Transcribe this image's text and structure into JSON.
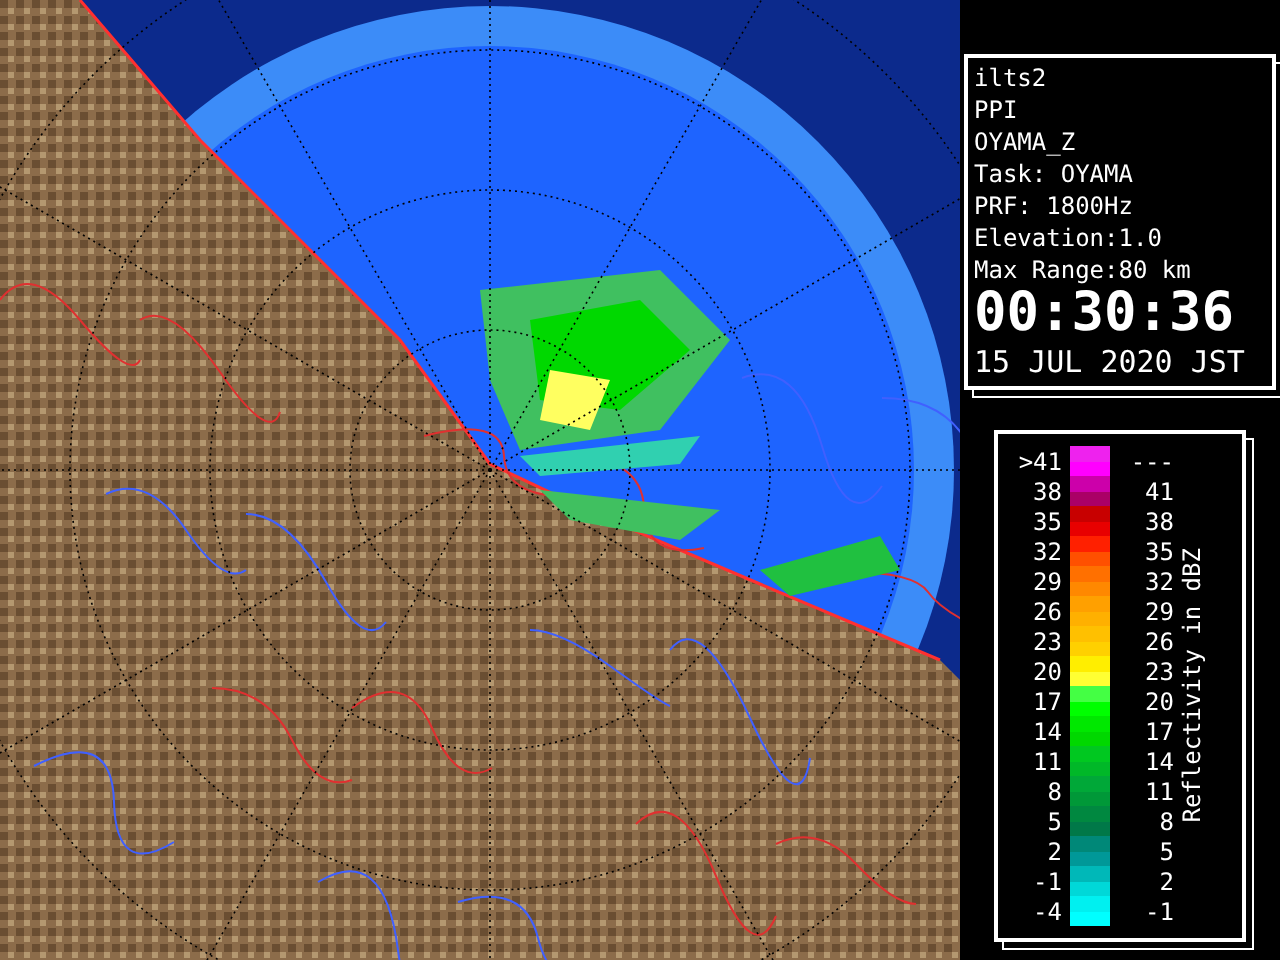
{
  "info": {
    "lines": [
      "ilts2",
      "PPI",
      "OYAMA_Z",
      "Task: OYAMA",
      "PRF: 1800Hz",
      "Elevation:1.0",
      "Max Range:80 km"
    ],
    "time": "00:30:36",
    "date": "15 JUL 2020 JST"
  },
  "legend": {
    "title": "Reflectivity in dBZ",
    "rows": [
      {
        "low": ">41",
        "high": "---",
        "bands": [
          {
            "color": "#ee22ee"
          },
          {
            "color": "#ff00ff"
          }
        ]
      },
      {
        "low": "38",
        "high": "41",
        "bands": [
          {
            "color": "#cc00aa"
          },
          {
            "color": "#aa0066"
          }
        ]
      },
      {
        "low": "35",
        "high": "38",
        "bands": [
          {
            "color": "#c80000"
          },
          {
            "color": "#e80000"
          }
        ]
      },
      {
        "low": "32",
        "high": "35",
        "bands": [
          {
            "color": "#ff2000"
          },
          {
            "color": "#ff5000"
          }
        ]
      },
      {
        "low": "29",
        "high": "32",
        "bands": [
          {
            "color": "#ff7000"
          },
          {
            "color": "#ff8800"
          }
        ]
      },
      {
        "low": "26",
        "high": "29",
        "bands": [
          {
            "color": "#ffa000"
          },
          {
            "color": "#ffb000"
          }
        ]
      },
      {
        "low": "23",
        "high": "26",
        "bands": [
          {
            "color": "#ffc000"
          },
          {
            "color": "#ffd000"
          }
        ]
      },
      {
        "low": "20",
        "high": "23",
        "bands": [
          {
            "color": "#ffee00"
          },
          {
            "color": "#ffff33"
          }
        ]
      },
      {
        "low": "17",
        "high": "20",
        "bands": [
          {
            "color": "#44ff44"
          },
          {
            "color": "#00ff00"
          }
        ]
      },
      {
        "low": "14",
        "high": "17",
        "bands": [
          {
            "color": "#00e800"
          },
          {
            "color": "#00d800"
          }
        ]
      },
      {
        "low": "11",
        "high": "14",
        "bands": [
          {
            "color": "#00c820"
          },
          {
            "color": "#00b828"
          }
        ]
      },
      {
        "low": "8",
        "high": "11",
        "bands": [
          {
            "color": "#00a838"
          },
          {
            "color": "#009838"
          }
        ]
      },
      {
        "low": "5",
        "high": "8",
        "bands": [
          {
            "color": "#008840"
          },
          {
            "color": "#007848"
          }
        ]
      },
      {
        "low": "2",
        "high": "5",
        "bands": [
          {
            "color": "#008878"
          },
          {
            "color": "#009898"
          }
        ]
      },
      {
        "low": "-1",
        "high": "2",
        "bands": [
          {
            "color": "#00b8b8"
          },
          {
            "color": "#00d8d8"
          }
        ]
      },
      {
        "low": "-4",
        "high": "-1",
        "bands": [
          {
            "color": "#00f0f0"
          },
          {
            "color": "#00ffff"
          }
        ]
      }
    ]
  }
}
